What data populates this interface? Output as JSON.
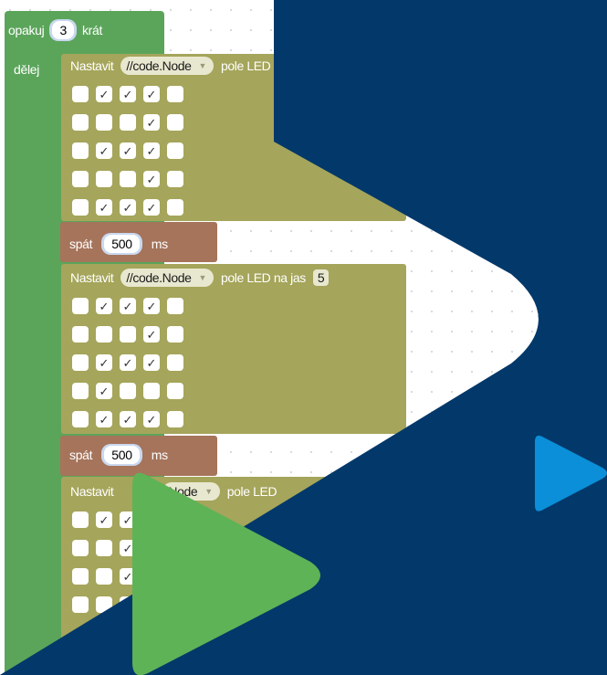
{
  "loop": {
    "label": "opakuj",
    "count": "3",
    "suffix": "krát",
    "do_label": "dělej"
  },
  "led_label": "Nastavit",
  "device": "//code.Node",
  "led_mid": "pole LED na jas",
  "led_mid_cut": "pole LED",
  "device_cut": "Node",
  "brightness": "5",
  "wait_label": "spát",
  "wait_value": "500",
  "wait_unit": "ms",
  "check": "✓",
  "grid1": [
    [
      0,
      1,
      1,
      1,
      0
    ],
    [
      0,
      0,
      0,
      1,
      0
    ],
    [
      0,
      1,
      1,
      1,
      0
    ],
    [
      0,
      0,
      0,
      1,
      0
    ],
    [
      0,
      1,
      1,
      1,
      0
    ]
  ],
  "grid2": [
    [
      0,
      1,
      1,
      1,
      0
    ],
    [
      0,
      0,
      0,
      1,
      0
    ],
    [
      0,
      1,
      1,
      1,
      0
    ],
    [
      0,
      1,
      0,
      0,
      0
    ],
    [
      0,
      1,
      1,
      1,
      0
    ]
  ],
  "grid3": [
    [
      0,
      1,
      1,
      0,
      0
    ],
    [
      0,
      0,
      1,
      0,
      0
    ],
    [
      0,
      0,
      1,
      0,
      0
    ],
    [
      0,
      0,
      0,
      0,
      0
    ]
  ],
  "colors": {
    "background": "#02386a",
    "play_white": "#ffffff",
    "play_green": "#5eb356",
    "play_blue": "#0a8fd8",
    "loop_block": "#5ba55b",
    "led_block": "#a5a55b",
    "wait_block": "#a5745b"
  }
}
